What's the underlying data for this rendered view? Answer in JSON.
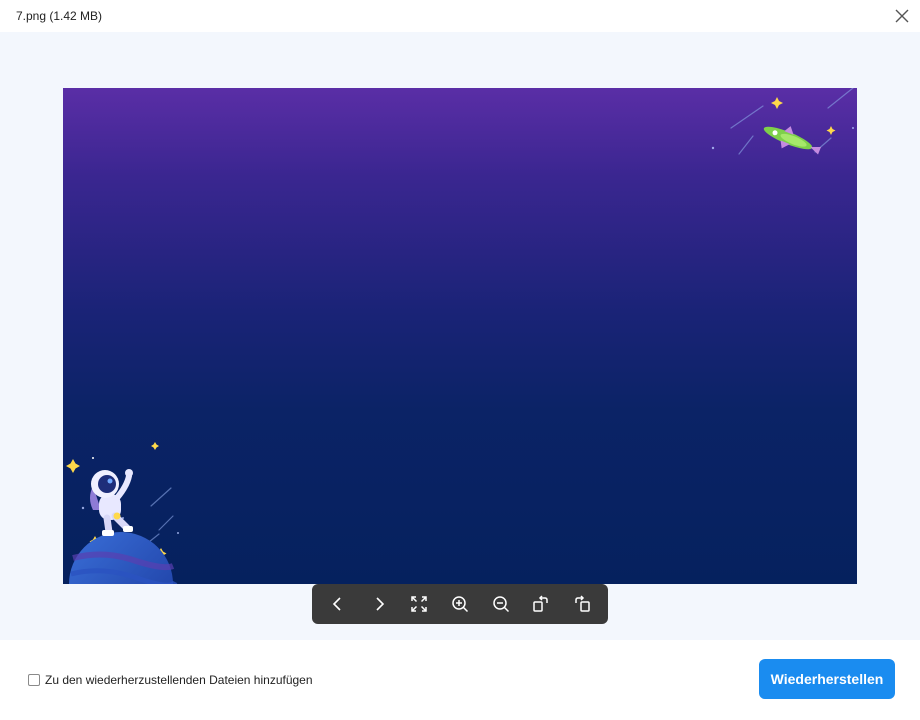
{
  "window": {
    "title": "7.png (1.42 MB)"
  },
  "viewer": {
    "toolbar": [
      {
        "name": "previous-button",
        "icon": "chevron-left-icon"
      },
      {
        "name": "next-button",
        "icon": "chevron-right-icon"
      },
      {
        "name": "fit-to-screen-button",
        "icon": "fullscreen-icon"
      },
      {
        "name": "zoom-in-button",
        "icon": "zoom-in-icon"
      },
      {
        "name": "zoom-out-button",
        "icon": "zoom-out-icon"
      },
      {
        "name": "rotate-right-button",
        "icon": "rotate-right-icon"
      },
      {
        "name": "rotate-left-button",
        "icon": "rotate-left-icon"
      }
    ]
  },
  "footer": {
    "checkbox_label": "Zu den wiederherzustellenden Dateien hinzufügen",
    "checkbox_checked": false,
    "restore_button": "Wiederherstellen"
  },
  "colors": {
    "accent": "#1a8cf0",
    "viewer_background": "#f3f7fd",
    "toolbar_background": "#3a3a3a",
    "image_top": "#5a2ea6",
    "image_bottom": "#05215e"
  }
}
